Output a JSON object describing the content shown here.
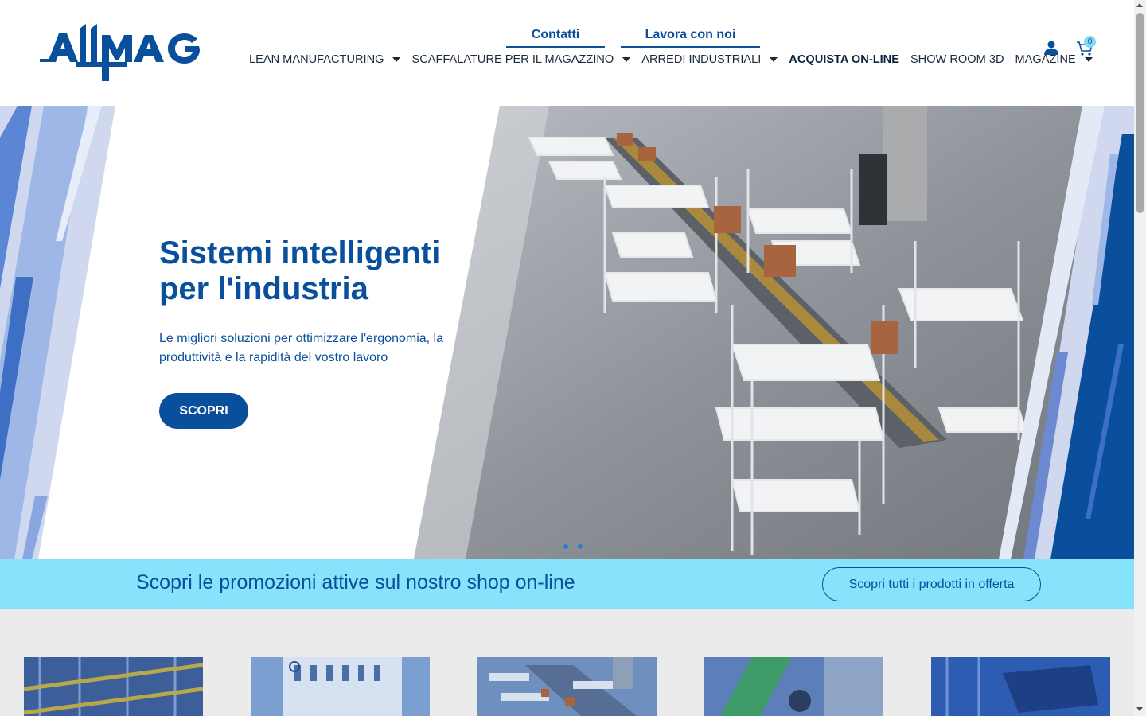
{
  "brand": {
    "logo_text": "ALLMAG",
    "color": "#0a4f9c",
    "accent": "#86e3fb"
  },
  "header": {
    "top_links": [
      "Contatti",
      "Lavora con noi"
    ],
    "nav": [
      {
        "label": "LEAN MANUFACTURING",
        "dropdown": true
      },
      {
        "label": "SCAFFALATURE PER IL MAGAZZINO",
        "dropdown": true
      },
      {
        "label": "ARREDI INDUSTRIALI",
        "dropdown": true
      },
      {
        "label": "ACQUISTA ON-LINE",
        "dropdown": false
      },
      {
        "label": "SHOW ROOM 3D",
        "dropdown": false
      },
      {
        "label": "MAGAZINE",
        "dropdown": true
      }
    ],
    "icons": [
      "user-icon",
      "cart-icon"
    ],
    "cart_count": "0"
  },
  "hero": {
    "title_line1": "Sistemi intelligenti",
    "title_line2": "per l'industria",
    "subtitle": "Le migliori soluzioni per ottimizzare l'ergonomia, la produttività e la rapidità del vostro lavoro",
    "button": "SCOPRI",
    "slides": 2
  },
  "promo": {
    "text": "Scopri le promozioni attive sul nostro shop on-line",
    "button": "Scopri tutti i prodotti in offerta"
  },
  "categories": [
    {
      "name": "category-warehouse-racking"
    },
    {
      "name": "category-tool-panel"
    },
    {
      "name": "category-lean-workstations"
    },
    {
      "name": "category-industrial-machine"
    },
    {
      "name": "category-automation"
    }
  ]
}
